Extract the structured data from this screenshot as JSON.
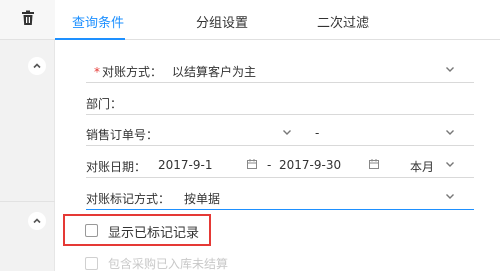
{
  "tabs": [
    {
      "label": "查询条件",
      "active": true
    },
    {
      "label": "分组设置",
      "active": false
    },
    {
      "label": "二次过滤",
      "active": false
    }
  ],
  "icons": {
    "delete": "trash-icon",
    "collapse": "chevron-up-icon",
    "dropdown": "chevron-down-icon",
    "calendar": "calendar-icon"
  },
  "form": {
    "reconcile_method": {
      "required_mark": "*",
      "label": "对账方式：",
      "value": "以结算客户为主"
    },
    "department": {
      "label": "部门："
    },
    "sales_order": {
      "label": "销售订单号：",
      "separator": "-"
    },
    "reconcile_date": {
      "label": "对账日期：",
      "start": "2017-9-1",
      "separator": "-",
      "end": "2017-9-30",
      "period": "本月"
    },
    "mark_method": {
      "label": "对账标记方式：",
      "value": "按单据"
    }
  },
  "options": {
    "show_marked": {
      "label": "显示已标记记录",
      "checked": false
    },
    "include_purchase": {
      "label": "包含采购已入库未结算",
      "checked": false,
      "disabled": true
    }
  },
  "colors": {
    "accent": "#1e90ff",
    "highlight": "#e53935",
    "required": "#e53935"
  }
}
